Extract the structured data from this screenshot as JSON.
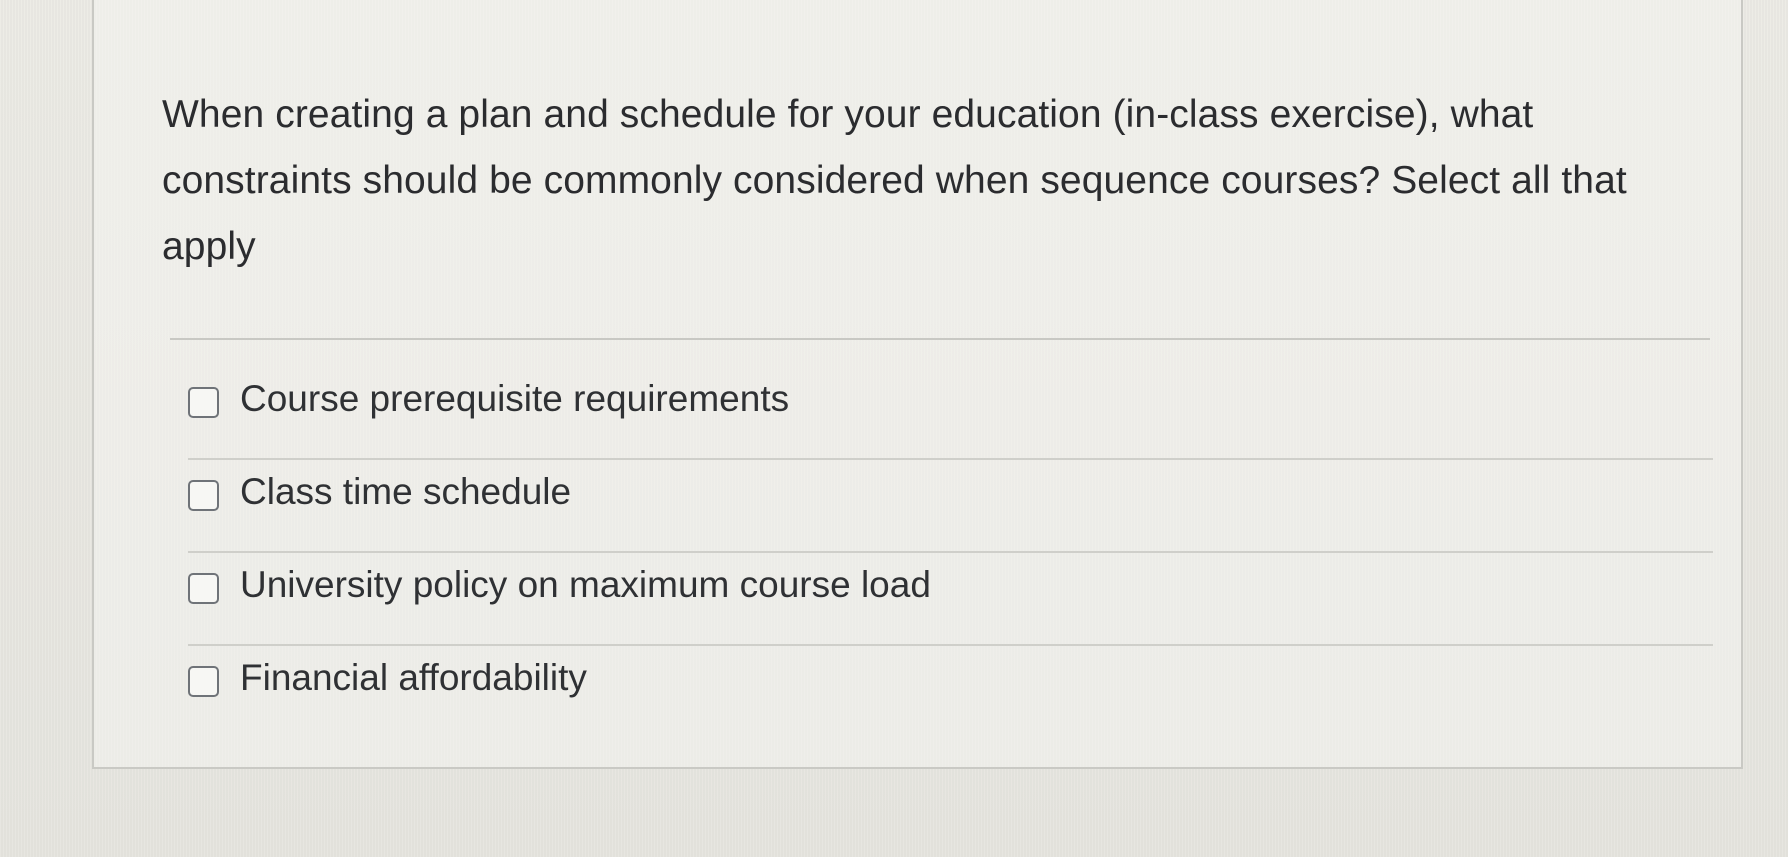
{
  "question": {
    "text": "When creating a plan and schedule for your education (in-class exercise), what constraints should be commonly considered when sequence courses? Select all that apply"
  },
  "choices": [
    {
      "label": "Course prerequisite requirements",
      "checked": false
    },
    {
      "label": "Class time schedule",
      "checked": false
    },
    {
      "label": "University policy on maximum course load",
      "checked": false
    },
    {
      "label": "Financial affordability",
      "checked": false
    }
  ]
}
